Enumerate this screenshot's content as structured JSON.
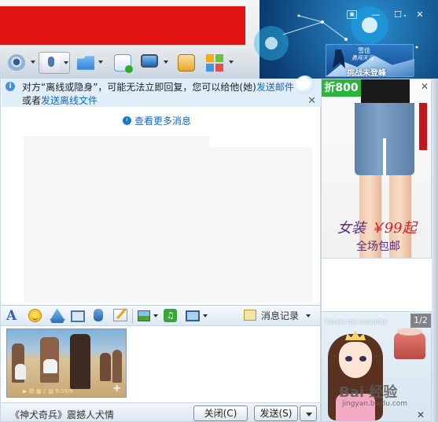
{
  "window": {
    "skin_button": "▣",
    "minimize": "—",
    "maximize": "☐",
    "close": "✕",
    "brand_badge": {
      "line1": "雪佳",
      "line2": "勇闯天涯",
      "line3": "挑战未登峰"
    }
  },
  "toolbar": {
    "icons": [
      "video-call-icon",
      "voice-call-icon",
      "file-transfer-icon",
      "message-icon",
      "screen-share-icon",
      "remote-assist-icon",
      "apps-icon"
    ]
  },
  "notice": {
    "icon": "i",
    "line1_prefix": "对方“离线或隐身”，可能无法立即回复，您可以给他(她)",
    "line1_link": "发送邮件",
    "line2_prefix": "或者",
    "line2_link": "发送离线文件",
    "close": "✕"
  },
  "chat": {
    "more_messages": "查看更多消息"
  },
  "input_toolbar": {
    "font_label": "A",
    "music_label": "♫",
    "history_label": "消息记录"
  },
  "input": {
    "video_caption": "▶ 刻 ▦ ♪ ▧ 9:59/9"
  },
  "bottom": {
    "promo_text": "《神犬奇兵》震撼人犬情",
    "close_button": "关闭(C)",
    "send_button": "发送(S)"
  },
  "ads": {
    "top": {
      "tag": "折800",
      "close": "✕",
      "text_prefix": "女装",
      "price": "￥99起",
      "text2": "全场包邮"
    },
    "bottom": {
      "tagline": "Retain the beautiful",
      "page": "1/2",
      "watermark": "Bai 经验",
      "watermark_sub": "jingyan.baidu.com",
      "close": "✕"
    }
  },
  "colors": {
    "link": "#1866c9",
    "notice_bg": "#dfeef9",
    "redacted": "#e21313",
    "ad_tag": "#2cb53b"
  }
}
